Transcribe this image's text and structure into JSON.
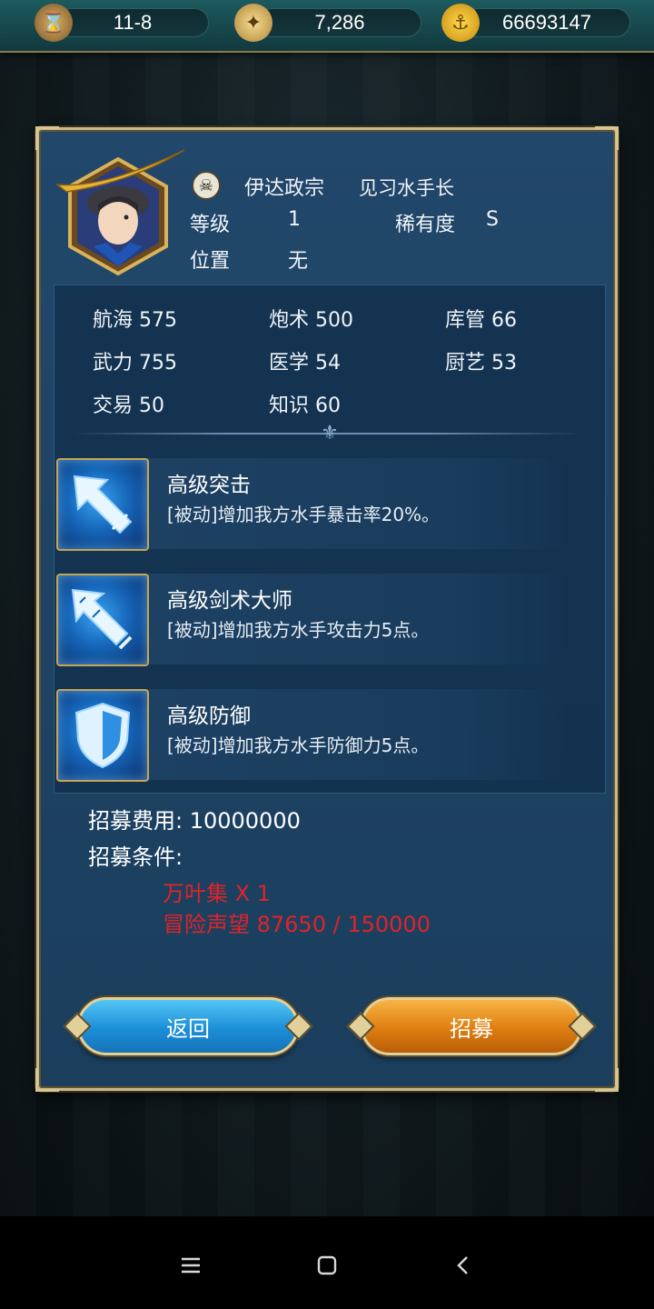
{
  "resources": {
    "stage": "11-8",
    "compass_value": "7,286",
    "gold": "66693147"
  },
  "character": {
    "name": "伊达政宗",
    "title": "见习水手长",
    "level_label": "等级",
    "level": "1",
    "rarity_label": "稀有度",
    "rarity": "S",
    "position_label": "位置",
    "position": "无"
  },
  "stats": [
    {
      "label": "航海 575"
    },
    {
      "label": "炮术 500"
    },
    {
      "label": "库管 66"
    },
    {
      "label": "武力 755"
    },
    {
      "label": "医学 54"
    },
    {
      "label": "厨艺 53"
    },
    {
      "label": "交易 50"
    },
    {
      "label": "知识 60"
    }
  ],
  "skills": [
    {
      "name": "高级突击",
      "desc": "[被动]增加我方水手暴击率20%。",
      "icon": "arrow-strike-icon"
    },
    {
      "name": "高级剑术大师",
      "desc": "[被动]增加我方水手攻击力5点。",
      "icon": "sword-icon"
    },
    {
      "name": "高级防御",
      "desc": "[被动]增加我方水手防御力5点。",
      "icon": "shield-icon"
    }
  ],
  "recruit": {
    "cost_text": "招募费用: 10000000",
    "conditions_label": "招募条件:",
    "conditions": [
      "万叶集 X 1",
      "冒险声望 87650 / 150000"
    ]
  },
  "buttons": {
    "back": "返回",
    "recruit": "招募"
  },
  "colors": {
    "panel": "#1f4466",
    "condition_red": "#e0232a",
    "back_button": "#1b8fd8",
    "recruit_button": "#df7e10"
  }
}
